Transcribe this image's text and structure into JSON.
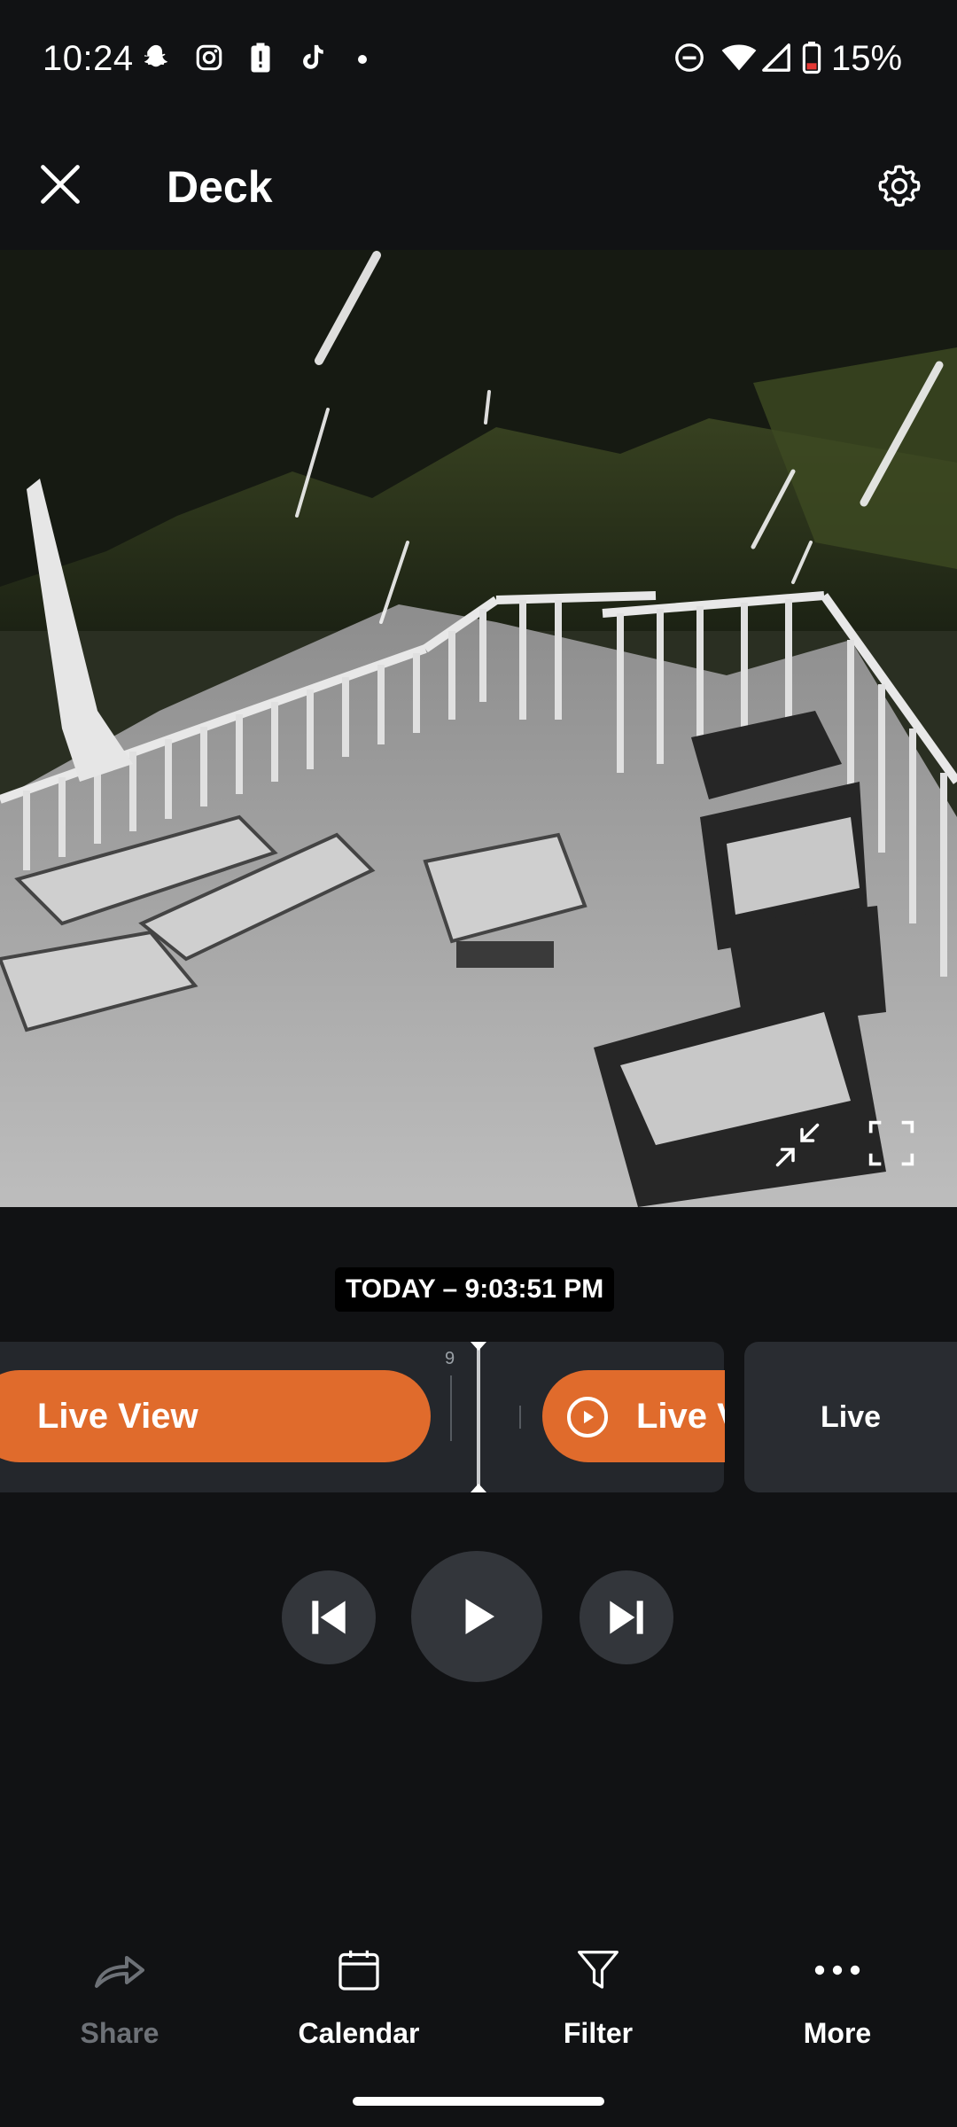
{
  "status_bar": {
    "time": "10:24",
    "battery": "15%",
    "icons": [
      "snapchat-icon",
      "instagram-icon",
      "battery-alert-icon",
      "tiktok-icon",
      "dot-icon",
      "do-not-disturb-icon",
      "wifi-icon",
      "signal-icon",
      "battery-icon"
    ]
  },
  "header": {
    "title": "Deck",
    "close_icon": "close-icon",
    "settings_icon": "gear-icon"
  },
  "feed": {
    "minimize_icon": "minimize-icon",
    "fullscreen_icon": "fullscreen-icon"
  },
  "timestamp": "TODAY – 9:03:51 PM",
  "timeline": {
    "tick_label": "9",
    "events": [
      {
        "label": "Live View"
      },
      {
        "label": "Live V"
      }
    ],
    "tile_label": "Live"
  },
  "playback": {
    "prev_icon": "skip-previous-icon",
    "play_icon": "play-icon",
    "next_icon": "skip-next-icon"
  },
  "bottom_nav": {
    "share": "Share",
    "calendar": "Calendar",
    "filter": "Filter",
    "more": "More"
  },
  "colors": {
    "accent": "#e06b2c",
    "background": "#111214",
    "disabled_text": "#6d7177"
  }
}
